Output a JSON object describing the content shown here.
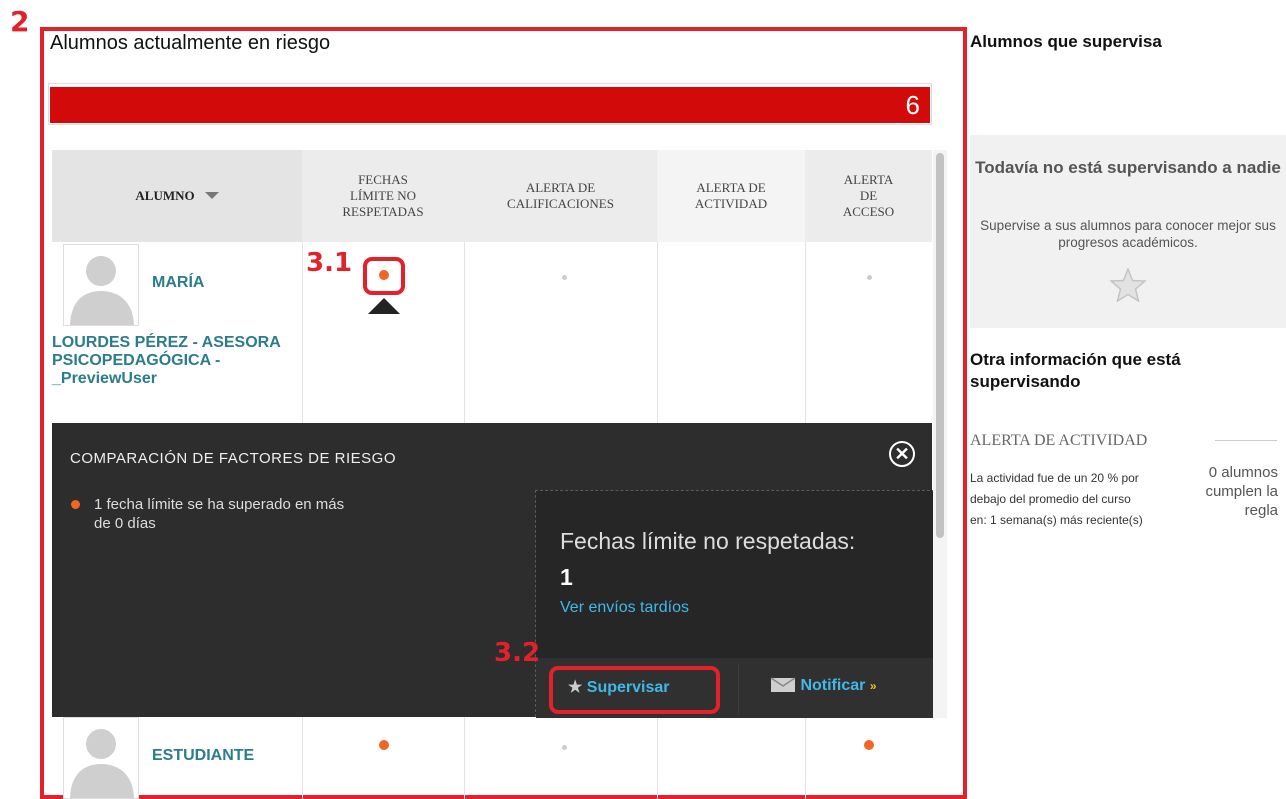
{
  "annotations": {
    "main_label": "2",
    "callout_1": "3.1",
    "callout_2": "3.2"
  },
  "main": {
    "title": "Alumnos actualmente en riesgo",
    "risk_count": "6",
    "columns": [
      "ALUMNO",
      "FECHAS LÍMITE NO RESPETADAS",
      "ALERTA DE CALIFICACIONES",
      "ALERTA DE ACTIVIDAD",
      "ALERTA DE ACCESO"
    ],
    "students": [
      {
        "name_first": "MARÍA",
        "name_rest": "LOURDES PÉREZ - ASESORA PSICOPEDAGÓGICA - _PreviewUser"
      },
      {
        "name_first": "ESTUDIANTE",
        "name_rest": ""
      }
    ]
  },
  "popover": {
    "title": "COMPARACIÓN DE FACTORES DE RIESGO",
    "factor": "1 fecha límite se ha superado en más de 0 días",
    "detail_label": "Fechas límite no respetadas:",
    "detail_value": "1",
    "detail_link": "Ver envíos tardíos",
    "supervise_label": "Supervisar",
    "notify_label": "Notificar"
  },
  "sidebar": {
    "title": "Alumnos que supervisa",
    "empty_title": "Todavía no está supervisando a nadie",
    "empty_desc": "Supervise a sus alumnos para conocer mejor sus progresos académicos.",
    "other_title": "Otra información que está supervisando",
    "alert_heading": "ALERTA DE ACTIVIDAD",
    "alert_desc": "La actividad fue de un 20 % por debajo del promedio del curso en: 1 semana(s) más reciente(s)",
    "alert_count": "0 alumnos cumplen la regla"
  },
  "colors": {
    "risk_red": "#d20a0a",
    "annotation_red": "#e3212b",
    "alert_orange": "#f26522",
    "link_teal": "#2b7c8c",
    "link_blue": "#41b8e8"
  },
  "icons": [
    "sort-down-icon",
    "avatar-icon",
    "close-icon",
    "star-icon",
    "mail-icon",
    "chevron-down-icon"
  ]
}
